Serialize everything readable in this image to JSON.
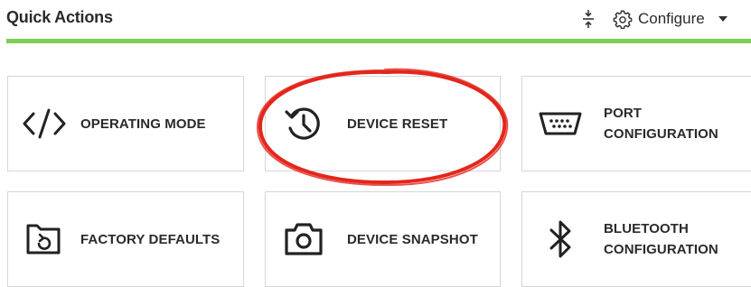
{
  "header": {
    "title": "Quick Actions",
    "configure_label": "Configure"
  },
  "tiles": [
    {
      "label": "OPERATING MODE",
      "icon": "code-icon"
    },
    {
      "label": "DEVICE RESET",
      "icon": "history-icon"
    },
    {
      "label_line1": "PORT",
      "label_line2": "CONFIGURATION",
      "icon": "serial-port-icon"
    },
    {
      "label": "FACTORY DEFAULTS",
      "icon": "restore-folder-icon"
    },
    {
      "label": "DEVICE SNAPSHOT",
      "icon": "camera-icon"
    },
    {
      "label_line1": "BLUETOOTH",
      "label_line2": "CONFIGURATION",
      "icon": "bluetooth-icon"
    }
  ],
  "colors": {
    "accent_bar": "#7ccf52",
    "annotation": "#e3261c",
    "tile_border": "#d6d6d6"
  }
}
